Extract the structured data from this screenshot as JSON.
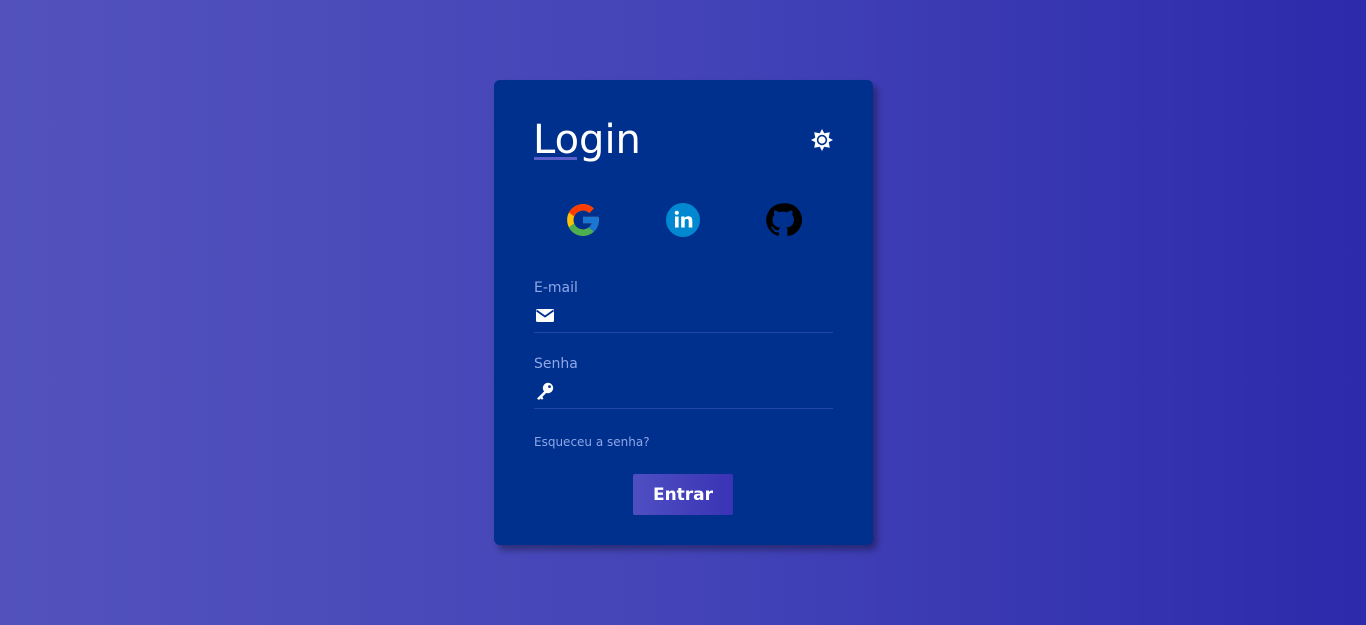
{
  "login": {
    "title": "Login",
    "theme_icon": "sun-icon",
    "social": [
      {
        "name": "google-icon"
      },
      {
        "name": "linkedin-icon"
      },
      {
        "name": "github-icon"
      }
    ],
    "email": {
      "label": "E-mail",
      "value": "",
      "placeholder": "",
      "icon": "envelope-icon"
    },
    "password": {
      "label": "Senha",
      "value": "",
      "placeholder": "",
      "icon": "key-icon"
    },
    "forgot_link": "Esqueceu a senha?",
    "submit_label": "Entrar"
  },
  "colors": {
    "card_background": "#00308d",
    "accent": "#4f4fc2",
    "label": "#8fa6e6"
  }
}
